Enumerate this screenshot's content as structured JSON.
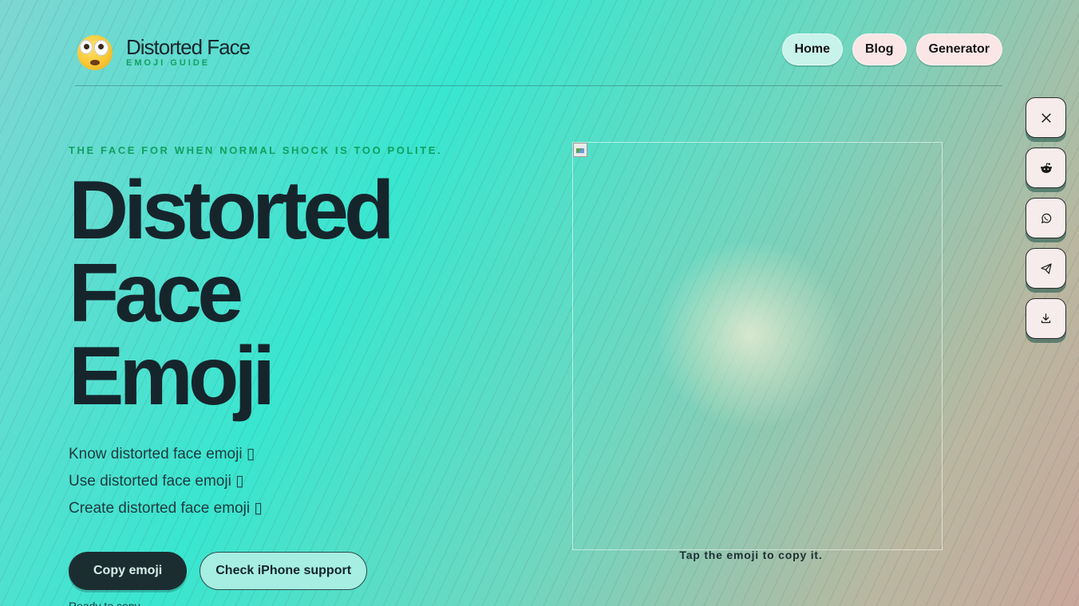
{
  "brand": {
    "name": "Distorted Face",
    "subtitle": "EMOJI GUIDE"
  },
  "nav": {
    "home": "Home",
    "blog": "Blog",
    "generator": "Generator"
  },
  "side_actions": [
    {
      "icon": "x-icon"
    },
    {
      "icon": "reddit-icon"
    },
    {
      "icon": "whatsapp-icon"
    },
    {
      "icon": "telegram-icon"
    },
    {
      "icon": "download-icon"
    }
  ],
  "hero": {
    "kicker": "THE FACE FOR WHEN NORMAL SHOCK IS TOO POLITE.",
    "title_line1": "Distorted",
    "title_line2": "Face",
    "title_line3": "Emoji",
    "lines": [
      "Know distorted face emoji ▯",
      "Use distorted face emoji ▯",
      "Create distorted face emoji ▯"
    ],
    "copy_button": "Copy emoji",
    "iphone_button": "Check iPhone support",
    "status": "Ready to copy"
  },
  "emoji_panel": {
    "hint": "Tap the emoji to copy it."
  },
  "colors": {
    "accent_green": "#11a060",
    "dark": "#1c2d31",
    "mint": "#a6eee2"
  }
}
